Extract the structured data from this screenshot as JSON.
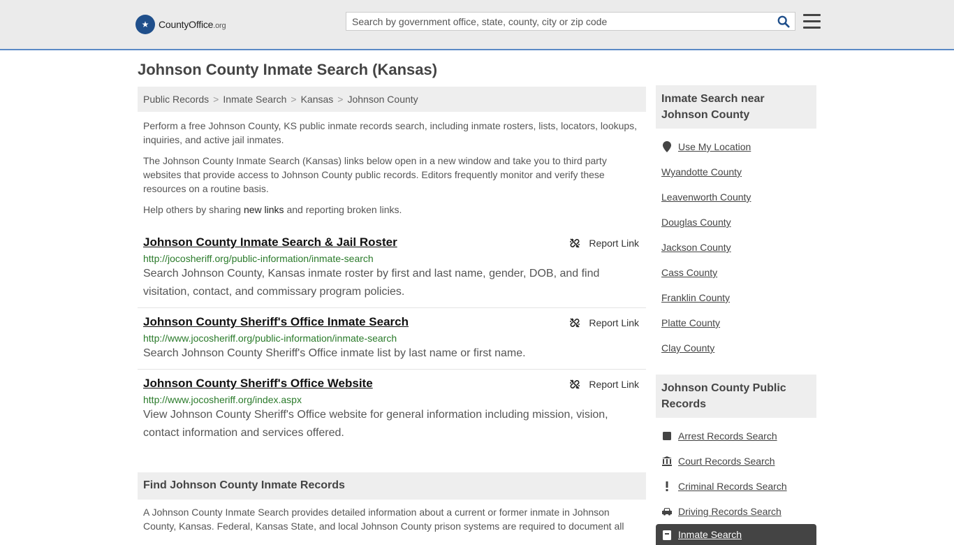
{
  "header": {
    "logo_brand": "CountyOffice",
    "logo_tld": ".org",
    "search_placeholder": "Search by government office, state, county, city or zip code"
  },
  "page_title": "Johnson County Inmate Search (Kansas)",
  "breadcrumb": [
    "Public Records",
    "Inmate Search",
    "Kansas",
    "Johnson County"
  ],
  "intro": {
    "p1": "Perform a free Johnson County, KS public inmate records search, including inmate rosters, lists, locators, lookups, inquiries, and active jail inmates.",
    "p2": "The Johnson County Inmate Search (Kansas) links below open in a new window and take you to third party websites that provide access to Johnson County public records. Editors frequently monitor and verify these resources on a routine basis.",
    "p3_prefix": "Help others by sharing ",
    "p3_link": "new links",
    "p3_suffix": " and reporting broken links."
  },
  "report_label": "Report Link",
  "results": [
    {
      "title": "Johnson County Inmate Search & Jail Roster",
      "url": "http://jocosheriff.org/public-information/inmate-search",
      "desc": "Search Johnson County, Kansas inmate roster by first and last name, gender, DOB, and find visitation, contact, and commissary program policies."
    },
    {
      "title": "Johnson County Sheriff's Office Inmate Search",
      "url": "http://www.jocosheriff.org/public-information/inmate-search",
      "desc": "Search Johnson County Sheriff's Office inmate list by last name or first name."
    },
    {
      "title": "Johnson County Sheriff's Office Website",
      "url": "http://www.jocosheriff.org/index.aspx",
      "desc": "View Johnson County Sheriff's Office website for general information including mission, vision, contact information and services offered."
    }
  ],
  "find_section": {
    "heading": "Find Johnson County Inmate Records",
    "text": "A Johnson County Inmate Search provides detailed information about a current or former inmate in Johnson County, Kansas. Federal, Kansas State, and local Johnson County prison systems are required to document all"
  },
  "sidebar": {
    "nearby_heading": "Inmate Search near Johnson County",
    "use_location": "Use My Location",
    "nearby": [
      "Wyandotte County",
      "Leavenworth County",
      "Douglas County",
      "Jackson County",
      "Cass County",
      "Franklin County",
      "Platte County",
      "Clay County"
    ],
    "records_heading": "Johnson County Public Records",
    "records": [
      {
        "label": "Arrest Records Search",
        "icon": "square-icon"
      },
      {
        "label": "Court Records Search",
        "icon": "courthouse-icon"
      },
      {
        "label": "Criminal Records Search",
        "icon": "exclamation-icon"
      },
      {
        "label": "Driving Records Search",
        "icon": "car-icon"
      }
    ],
    "active_item": "Inmate Search"
  }
}
